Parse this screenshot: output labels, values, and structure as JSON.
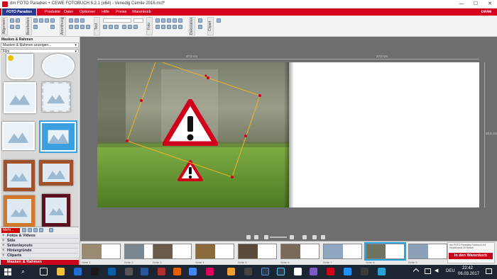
{
  "window": {
    "title": "dm FOTO Paradies + CEWE FOTOBUCH 6.2.1 (x64) - Venedig Cemile 2016.mcf*",
    "minimize": "—",
    "maximize": "☐",
    "close": "✕"
  },
  "menubar": {
    "logo": "FOTO Paradies",
    "items": [
      "Produkte",
      "Datei",
      "Optionen",
      "Hilfe",
      "Preise",
      "Warenkorb"
    ],
    "brand": "cewe"
  },
  "toolbar_tabs": [
    "Allgemein",
    "Bearbeiten",
    "Anordnung",
    "Text",
    "Foto",
    "Dekoration",
    "Clipart"
  ],
  "sidebar": {
    "header": "Masken & Rahmen",
    "dropdown1": "Masken & Rahmen anzeigen...",
    "dropdown2": "Film",
    "more_button": "Mehr...",
    "categories": [
      "Fotos & Videos",
      "Stile",
      "Seitenlayouts",
      "Hintergründe",
      "Cliparts"
    ],
    "active_category": "Masken & Rahmen"
  },
  "canvas": {
    "left_ruler": "27,0 cm",
    "right_ruler": "27,0 cm",
    "height_label": "20,5 cm"
  },
  "filmstrip": {
    "pages": [
      "Seite 1",
      "Seite 2",
      "Seite 3",
      "Seite 4",
      "Seite 5",
      "Seite 6",
      "Seite 7",
      "Seite 8",
      "Seite 9",
      "Seite 10"
    ],
    "active_page": 8
  },
  "cart": {
    "info": "dm FOTO Paradies Fotobuch A4 Hochformat 26 Seiten",
    "button": "In den Warenkorb"
  },
  "taskbar": {
    "lang": "DEU",
    "time": "22:42",
    "date": "06.03.2017"
  },
  "colors": {
    "brand_red": "#d5001c",
    "warning_red": "#d0021b",
    "selection_yellow": "#f0b429",
    "active_blue": "#27a3e0"
  }
}
